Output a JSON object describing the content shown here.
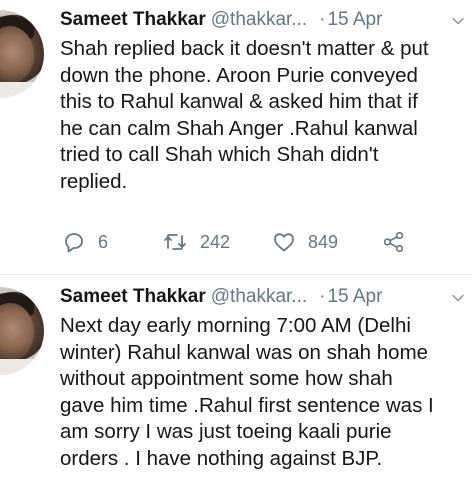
{
  "tweets": [
    {
      "author": "Sameet Thakkar",
      "handle": "@thakkar...",
      "separator": "·",
      "time": "15 Apr",
      "text": "Shah replied back it doesn't matter & put\ndown the phone. Aroon Purie conveyed\nthis to Rahul kanwal & asked him that if\nhe can calm Shah Anger .Rahul kanwal\ntried to call Shah which Shah didn't\nreplied.",
      "replies": "6",
      "retweets": "242",
      "likes": "849",
      "icons": {
        "reply": "reply-icon",
        "retweet": "retweet-icon",
        "like": "heart-icon",
        "share": "share-icon",
        "menu": "chevron-down-icon"
      }
    },
    {
      "author": "Sameet Thakkar",
      "handle": "@thakkar...",
      "separator": "·",
      "time": "15 Apr",
      "text": "Next day early morning 7:00 AM (Delhi\nwinter) Rahul kanwal was on shah home\nwithout appointment some how shah\ngave him time .Rahul first sentence was I\nam sorry I was just toeing kaali purie\norders . I have nothing against BJP.",
      "icons": {
        "menu": "chevron-down-icon"
      }
    }
  ],
  "colors": {
    "text": "#14171a",
    "secondary": "#657786",
    "divider": "#e6ecf0"
  }
}
